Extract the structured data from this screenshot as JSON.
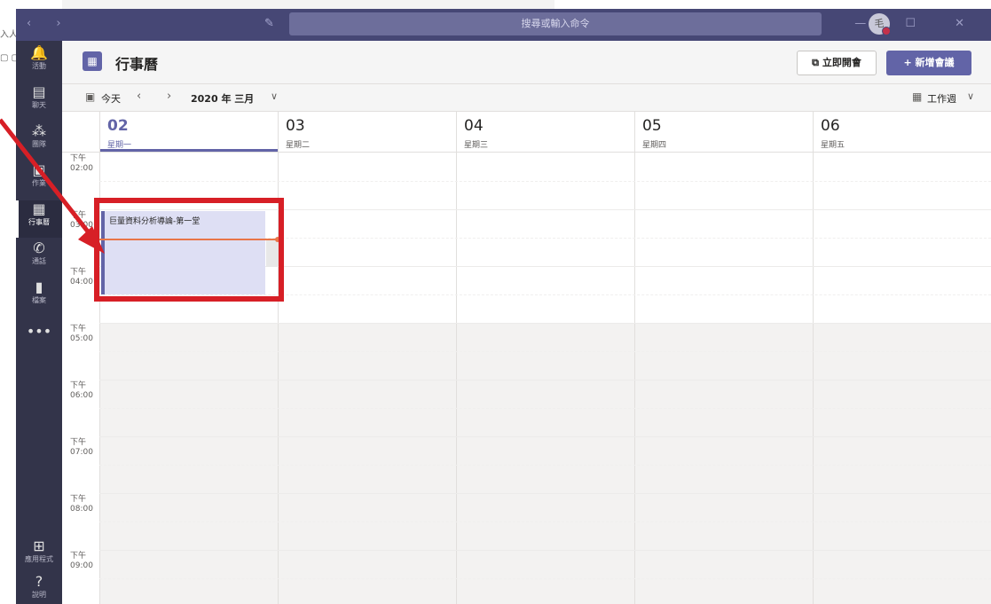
{
  "background_page": {
    "text_fragment": "入人",
    "icons_fragment": "▢ ▢"
  },
  "titlebar": {
    "nav_icons": "‹ ›",
    "compose_icon": "compose-icon",
    "search_placeholder": "搜尋或輸入命令",
    "avatar_initial": "毛",
    "window_controls": "— ☐ ✕"
  },
  "rail": {
    "items": [
      {
        "icon": "bell-icon",
        "glyph": "🔔",
        "label": "活動"
      },
      {
        "icon": "chat-icon",
        "glyph": "▤",
        "label": "聊天"
      },
      {
        "icon": "teams-icon",
        "glyph": "⁂",
        "label": "團隊"
      },
      {
        "icon": "assignments-icon",
        "glyph": "▣",
        "label": "作業"
      },
      {
        "icon": "calendar-icon",
        "glyph": "▦",
        "label": "行事曆"
      },
      {
        "icon": "calls-icon",
        "glyph": "✆",
        "label": "通話"
      },
      {
        "icon": "files-icon",
        "glyph": "▮",
        "label": "檔案"
      },
      {
        "icon": "more-icon",
        "glyph": "•••",
        "label": ""
      }
    ],
    "bottom": [
      {
        "icon": "apps-icon",
        "glyph": "⊞",
        "label": "應用程式"
      },
      {
        "icon": "help-icon",
        "glyph": "?",
        "label": "說明"
      }
    ]
  },
  "header": {
    "icon_glyph": "▦",
    "title": "行事曆",
    "meet_now_label": "立即開會",
    "meet_now_icon": "🎥",
    "new_meeting_label": "新增會議",
    "new_meeting_icon": "+"
  },
  "toolbar": {
    "today_icon": "▣",
    "today_label": "今天",
    "prev": "‹",
    "next": "›",
    "month_label": "2020 年 三月",
    "month_caret": "∨",
    "view_icon": "▦",
    "view_label": "工作週",
    "view_caret": "∨"
  },
  "days": [
    {
      "num": "02",
      "weekday": "星期一",
      "today": true
    },
    {
      "num": "03",
      "weekday": "星期二",
      "today": false
    },
    {
      "num": "04",
      "weekday": "星期三",
      "today": false
    },
    {
      "num": "05",
      "weekday": "星期四",
      "today": false
    },
    {
      "num": "06",
      "weekday": "星期五",
      "today": false
    }
  ],
  "time_slots": [
    {
      "ampm": "下午",
      "time": "02:00"
    },
    {
      "ampm": "下午",
      "time": "03:00"
    },
    {
      "ampm": "下午",
      "time": "04:00"
    },
    {
      "ampm": "下午",
      "time": "05:00"
    },
    {
      "ampm": "下午",
      "time": "06:00"
    },
    {
      "ampm": "下午",
      "time": "07:00"
    },
    {
      "ampm": "下午",
      "time": "08:00"
    },
    {
      "ampm": "下午",
      "time": "09:00"
    }
  ],
  "event": {
    "title": "巨量資料分析導論-第一堂"
  },
  "colors": {
    "accent": "#6264a7",
    "titlebar": "#464775",
    "rail": "#33344a",
    "now_line": "#e97548",
    "highlight": "#d71f26"
  }
}
